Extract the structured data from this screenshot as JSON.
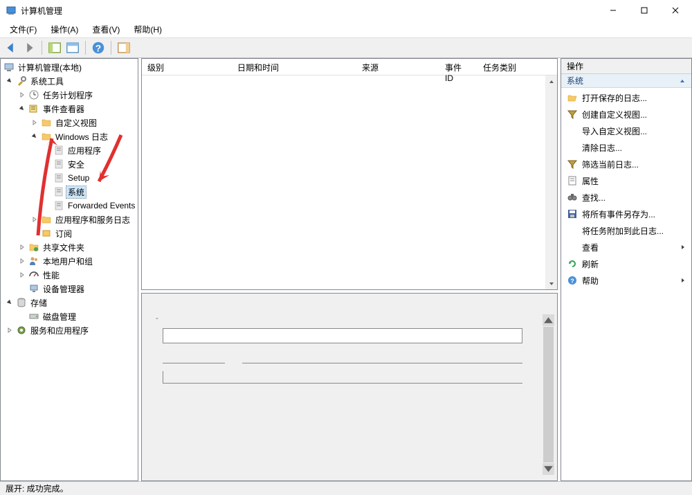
{
  "window": {
    "title": "计算机管理"
  },
  "menu": {
    "file": "文件(F)",
    "action": "操作(A)",
    "view": "查看(V)",
    "help": "帮助(H)"
  },
  "tree": {
    "root": "计算机管理(本地)",
    "system_tools": "系统工具",
    "task_scheduler": "任务计划程序",
    "event_viewer": "事件查看器",
    "custom_views": "自定义视图",
    "windows_logs": "Windows 日志",
    "app": "应用程序",
    "security": "安全",
    "setup": "Setup",
    "system": "系统",
    "forwarded": "Forwarded Events",
    "app_services": "应用程序和服务日志",
    "subscriptions": "订阅",
    "shared_folders": "共享文件夹",
    "local_users": "本地用户和组",
    "performance": "性能",
    "device_manager": "设备管理器",
    "storage": "存储",
    "disk_mgmt": "磁盘管理",
    "services_apps": "服务和应用程序"
  },
  "list": {
    "col_level": "级别",
    "col_datetime": "日期和时间",
    "col_source": "来源",
    "col_eventid": "事件 ID",
    "col_category": "任务类别"
  },
  "actions": {
    "header": "操作",
    "section": "系统",
    "open_saved": "打开保存的日志...",
    "create_custom": "创建自定义视图...",
    "import_custom": "导入自定义视图...",
    "clear_log": "清除日志...",
    "filter_current": "筛选当前日志...",
    "properties": "属性",
    "find": "查找...",
    "save_all": "将所有事件另存为...",
    "attach_task": "将任务附加到此日志...",
    "view": "查看",
    "refresh": "刷新",
    "help": "帮助"
  },
  "status": {
    "text": "展开:  成功完成。"
  }
}
